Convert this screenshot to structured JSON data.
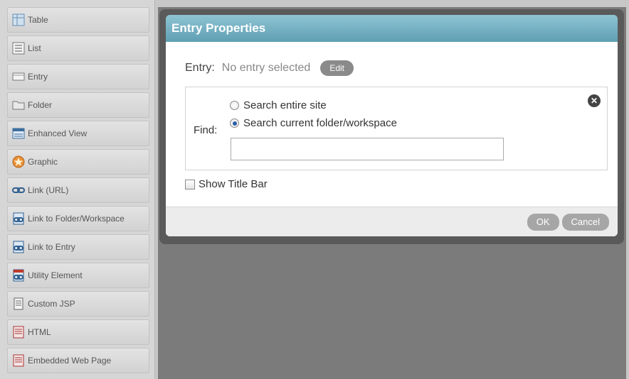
{
  "palette": {
    "items": [
      {
        "label": "Table",
        "icon": "table-icon"
      },
      {
        "label": "List",
        "icon": "list-icon"
      },
      {
        "label": "Entry",
        "icon": "entry-icon"
      },
      {
        "label": "Folder",
        "icon": "folder-icon"
      },
      {
        "label": "Enhanced View",
        "icon": "enhanced-view-icon"
      },
      {
        "label": "Graphic",
        "icon": "graphic-icon"
      },
      {
        "label": "Link (URL)",
        "icon": "link-icon"
      },
      {
        "label": "Link to Folder/Workspace",
        "icon": "link-folder-icon"
      },
      {
        "label": "Link to Entry",
        "icon": "link-entry-icon"
      },
      {
        "label": "Utility Element",
        "icon": "utility-element-icon"
      },
      {
        "label": "Custom JSP",
        "icon": "custom-jsp-icon"
      },
      {
        "label": "HTML",
        "icon": "html-icon"
      },
      {
        "label": "Embedded Web Page",
        "icon": "embedded-web-page-icon"
      }
    ]
  },
  "dialog": {
    "title": "Entry Properties",
    "entry_label": "Entry:",
    "entry_value": "No entry selected",
    "edit_label": "Edit",
    "find_label": "Find:",
    "radio_entire_site": "Search entire site",
    "radio_current_folder": "Search current folder/workspace",
    "selected_radio": "Search current folder/workspace",
    "search_value": "",
    "show_title_bar_label": "Show Title Bar",
    "show_title_bar_checked": false,
    "ok_label": "OK",
    "cancel_label": "Cancel"
  },
  "colors": {
    "header_blue": "#6fadc0",
    "workspace_gray": "#7b7b7b",
    "button_gray": "#a6a6a6"
  }
}
